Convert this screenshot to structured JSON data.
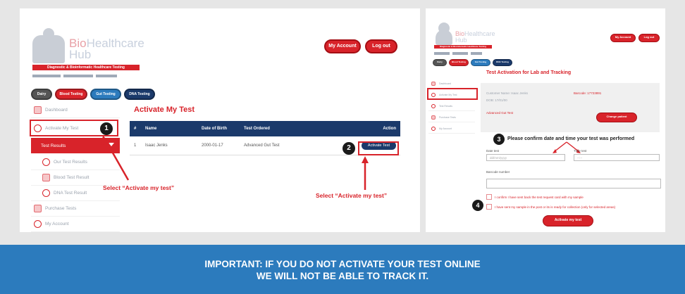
{
  "brand": {
    "name_a": "Bio",
    "name_b": "Healthcare",
    "name_c": "Hub",
    "tagline": "Diagnostic & Bioinformatic Healthcare Testing"
  },
  "header": {
    "my_account": "My Account",
    "log_out": "Log out"
  },
  "categories": [
    {
      "label": "Dairy",
      "color": "#555555"
    },
    {
      "label": "Blood Testing",
      "color": "#d8232a"
    },
    {
      "label": "Gut Testing",
      "color": "#2c7bbd"
    },
    {
      "label": "DNA Testing",
      "color": "#1b3a6b"
    }
  ],
  "sidebar": {
    "items": [
      {
        "label": "Dashboard"
      },
      {
        "label": "Activate My Test"
      },
      {
        "label": "Test Results"
      },
      {
        "label": "Our Test Results"
      },
      {
        "label": "Blood Test Result"
      },
      {
        "label": "DNA Test Result"
      },
      {
        "label": "Purchase Tests"
      },
      {
        "label": "My Account"
      }
    ]
  },
  "left_main": {
    "title": "Activate My Test",
    "columns": [
      "#",
      "Name",
      "Date of Birth",
      "Test Ordered",
      "Action"
    ],
    "rows": [
      {
        "num": "1",
        "name": "Isaac Jenks",
        "dob": "2000-01-17",
        "test": "Advanced Gut Test",
        "action": "Activate Test"
      }
    ]
  },
  "annotations": {
    "badge1": "1",
    "badge2": "2",
    "badge3": "3",
    "badge4": "4",
    "select1": "Select “Activate my test”",
    "select2": "Select “Activate my test”",
    "confirm": "Please confirm date and time your test was performed"
  },
  "right_main": {
    "title": "Test Activation for Lab and Tracking",
    "info": {
      "customer_label": "Customer Name: Isaac Jenks",
      "barcode_label": "Barcode: 17723891",
      "dob_label": "DOB: 17/01/00",
      "test_label": "Advanced Gut Test",
      "change_btn": "Change patient"
    },
    "date_label": "Date test",
    "time_label": "Time test",
    "date_placeholder": "dd/mm/yyyy",
    "time_placeholder": "--:--",
    "barcode_field_label": "Barcode number",
    "check1": "I confirm I have sent back the test request card with my sample",
    "check2": "I have sent my sample in the post or its is ready for collection (only for selected areas)",
    "activate_btn": "Activate my test"
  },
  "footer": {
    "line1": "IMPORTANT: IF YOU DO NOT ACTIVATE YOUR TEST ONLINE",
    "line2": "WE WILL NOT BE ABLE TO TRACK IT."
  },
  "colors": {
    "red": "#d8232a",
    "navy": "#1b3a6b",
    "blue": "#2c7bbd"
  }
}
